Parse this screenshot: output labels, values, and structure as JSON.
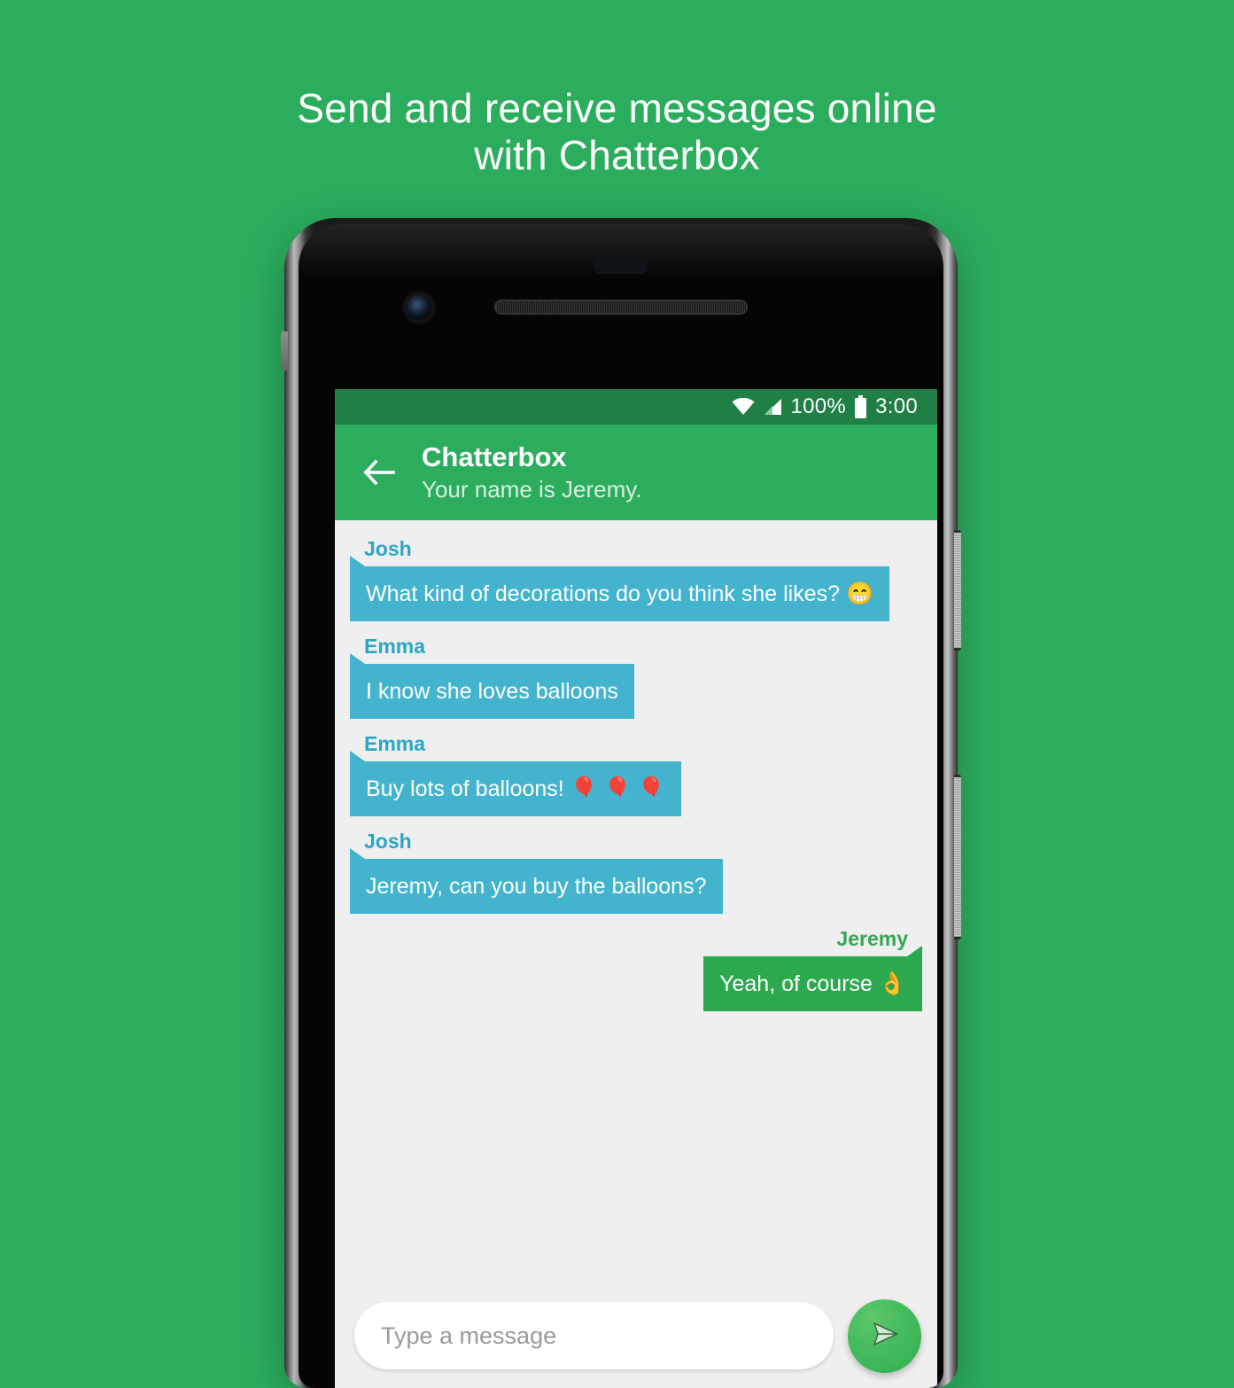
{
  "headline": {
    "line1": "Send and receive messages online",
    "line2": "with Chatterbox"
  },
  "colors": {
    "background_green": "#2CAD5E",
    "statusbar_green": "#1F7F45",
    "incoming_bubble": "#44B3CE",
    "outgoing_bubble": "#2CA94F",
    "incoming_name": "#2BA6C6",
    "outgoing_name": "#33A852",
    "chat_background": "#EFEFEF"
  },
  "status_bar": {
    "wifi_icon": "wifi-icon",
    "signal_icon": "signal-icon",
    "battery_percent": "100%",
    "battery_icon": "battery-full-icon",
    "time": "3:00"
  },
  "app_bar": {
    "back_icon": "back-arrow-icon",
    "title": "Chatterbox",
    "subtitle": "Your name is Jeremy."
  },
  "messages": [
    {
      "sender": "Josh",
      "text": "What kind of decorations do you think she likes? 😁",
      "outgoing": false
    },
    {
      "sender": "Emma",
      "text": "I know she loves balloons",
      "outgoing": false
    },
    {
      "sender": "Emma",
      "text": "Buy lots of balloons! 🎈 🎈 🎈",
      "outgoing": false
    },
    {
      "sender": "Josh",
      "text": "Jeremy, can you buy the balloons?",
      "outgoing": false
    },
    {
      "sender": "Jeremy",
      "text": "Yeah, of course 👌",
      "outgoing": true
    }
  ],
  "composer": {
    "input_value": "",
    "input_placeholder": "Type a message",
    "send_icon": "send-icon"
  },
  "device": {
    "camera_icon": "front-camera-icon",
    "earpiece_icon": "earpiece-speaker-icon",
    "power_button": "power-button",
    "volume_button": "volume-button"
  }
}
